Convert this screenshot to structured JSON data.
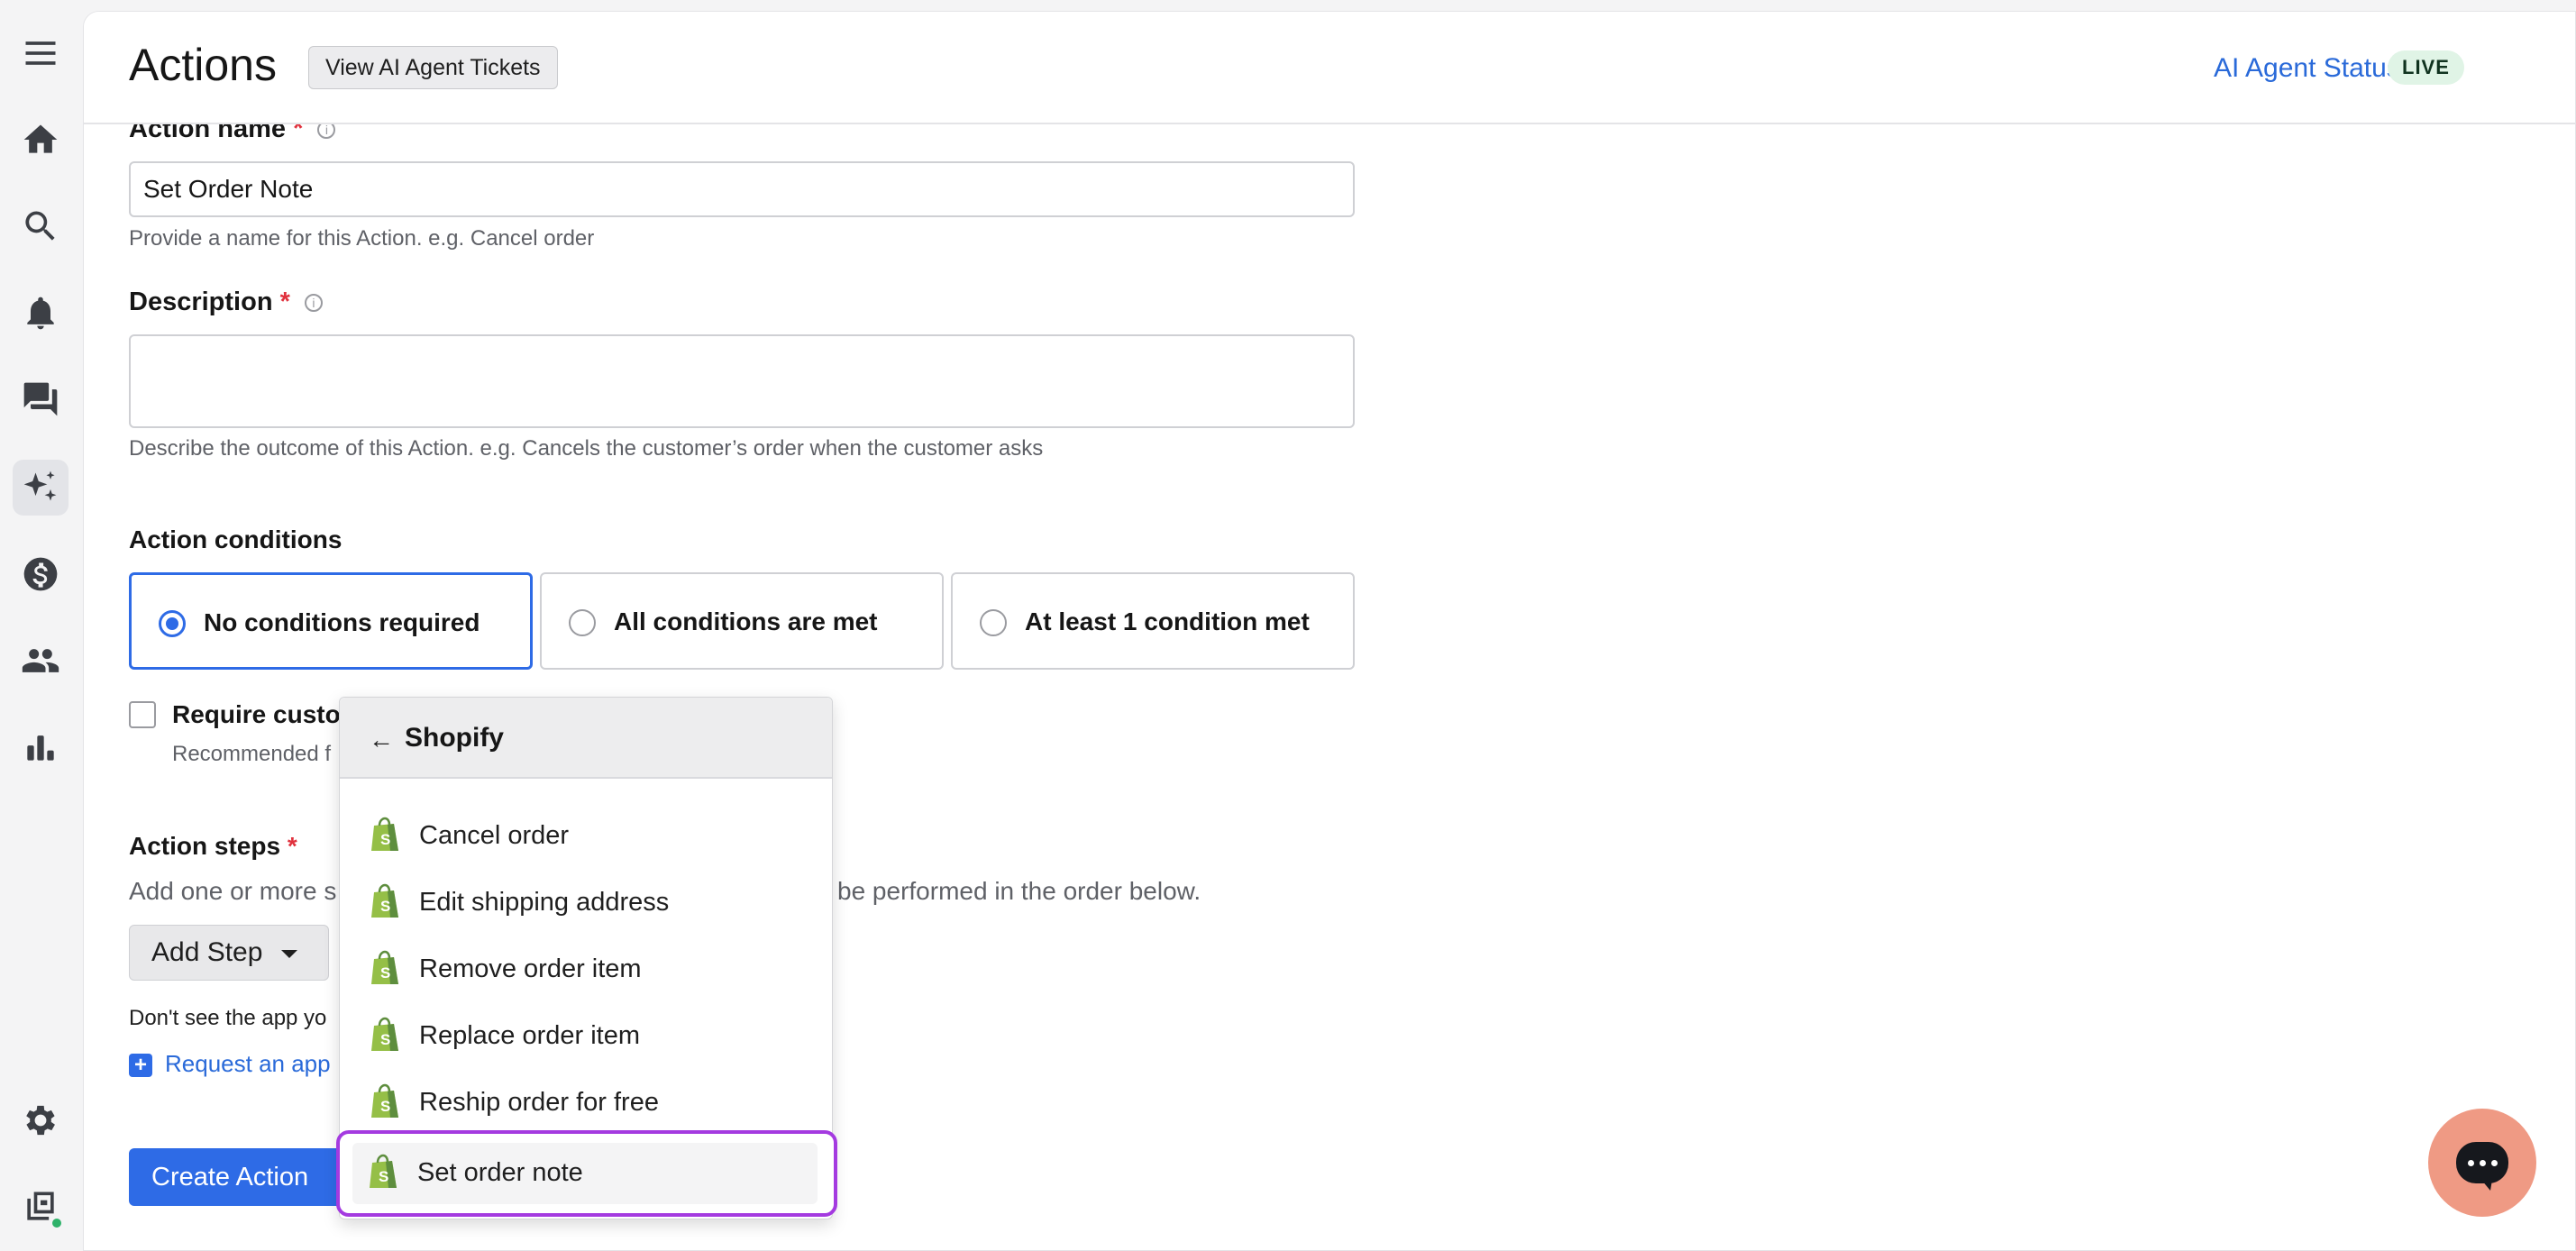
{
  "sidebar": {
    "icons": [
      "menu-icon",
      "home-icon",
      "search-icon",
      "bell-icon",
      "chat-icon",
      "sparkle-icon",
      "dollar-icon",
      "users-icon",
      "chart-icon",
      "gear-icon",
      "app-switch-icon"
    ],
    "active": "sparkle-icon",
    "status_dot_color": "#2fb26a"
  },
  "header": {
    "title": "Actions",
    "view_tickets_label": "View AI Agent Tickets",
    "status_link": "AI Agent Status",
    "live_badge": "LIVE"
  },
  "form": {
    "action_name": {
      "label": "Action name",
      "required_mark": "*",
      "value": "Set Order Note",
      "hint": "Provide a name for this Action. e.g. Cancel order"
    },
    "description": {
      "label": "Description",
      "required_mark": "*",
      "value": "",
      "hint": "Describe the outcome of this Action. e.g. Cancels the customer’s order when the customer asks"
    },
    "conditions": {
      "label": "Action conditions",
      "options": [
        "No conditions required",
        "All conditions are met",
        "At least 1 condition met"
      ],
      "selected": "No conditions required"
    },
    "require_confirmation": {
      "label_visible": "Require custo",
      "hint_visible": "Recommended f"
    },
    "steps": {
      "label": "Action steps",
      "required_mark": "*",
      "hint_left": "Add one or more s",
      "hint_right": "be performed in the order below.",
      "add_step_label": "Add Step",
      "missing_app_text": "Don't see the app yo",
      "request_app_label": "Request an app"
    },
    "create_label": "Create Action"
  },
  "dropdown": {
    "back_arrow": "←",
    "title": "Shopify",
    "items": [
      "Cancel order",
      "Edit shipping address",
      "Remove order item",
      "Replace order item",
      "Reship order for free",
      "Set order note"
    ],
    "highlighted": "Set order note",
    "icon": "shopify-bag-icon"
  },
  "colors": {
    "accent": "#2e6be6",
    "highlight_border": "#a43ae0",
    "chat_bubble": "#ef9a84",
    "shopify_green": "#95bf47"
  }
}
